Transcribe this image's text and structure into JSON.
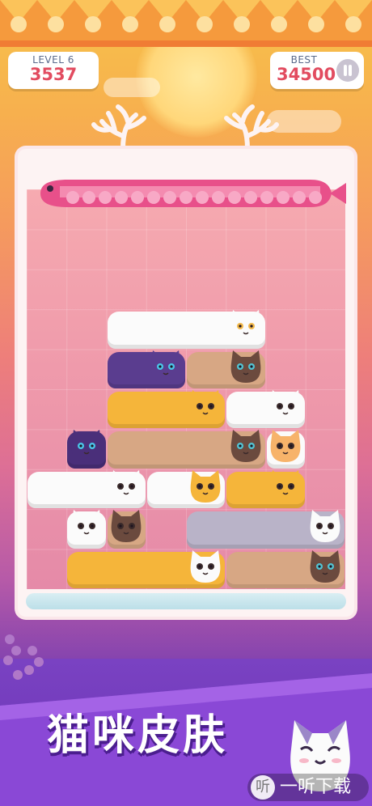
{
  "hud": {
    "level_label": "LEVEL 6",
    "score": "3537",
    "best_label": "BEST",
    "best_score": "34500"
  },
  "banner": {
    "title": "猫咪皮肤"
  },
  "watermark": {
    "icon": "听",
    "text": "一听下载"
  },
  "colors": {
    "score_red": "#e24c60",
    "frame": "#fdf3f3",
    "grid_pink": "#f2a0ac",
    "banner_purple": "#6a34b6"
  },
  "icons": [
    "pause-icon",
    "antler-icon",
    "fish-progress-icon",
    "lightning-icon"
  ],
  "board": {
    "rows": 10,
    "cols": 8,
    "cats": [
      {
        "row": 3,
        "col": 2,
        "len": 4,
        "color": "#fbfbfb",
        "face": "#fbfbfb",
        "eyes": "#f2b84a"
      },
      {
        "row": 4,
        "col": 2,
        "len": 2,
        "color": "#5a3d8f",
        "face": "#5a3d8f",
        "eyes": "#4ac5e8"
      },
      {
        "row": 4,
        "col": 4,
        "len": 2,
        "color": "#d7a784",
        "face": "#6b4a3e",
        "eyes": "#52c3d3"
      },
      {
        "row": 5,
        "col": 2,
        "len": 3,
        "color": "#f5b53a",
        "face": "#f5b53a",
        "eyes": "#3a2a2a"
      },
      {
        "row": 5,
        "col": 5,
        "len": 2,
        "color": "#fbfbfb",
        "face": "#fbfbfb",
        "eyes": "#3a2a2a"
      },
      {
        "row": 6,
        "col": 1,
        "len": 1,
        "color": "#4a2f7a",
        "face": "#4a2f7a",
        "eyes": "#4ac5e8"
      },
      {
        "row": 6,
        "col": 2,
        "len": 4,
        "color": "#d7a784",
        "face": "#6b4a3e",
        "eyes": "#52c3d3"
      },
      {
        "row": 6,
        "col": 6,
        "len": 1,
        "color": "#fbfbfb",
        "face": "#f7b36a",
        "eyes": "#3a2a2a"
      },
      {
        "row": 7,
        "col": 0,
        "len": 3,
        "color": "#fbfbfb",
        "face": "#fbfbfb",
        "eyes": "#3a2a2a"
      },
      {
        "row": 7,
        "col": 3,
        "len": 2,
        "color": "#fbfbfb",
        "face": "#f5b53a",
        "eyes": "#3a2a2a"
      },
      {
        "row": 7,
        "col": 5,
        "len": 2,
        "color": "#f5b53a",
        "face": "#f5b53a",
        "eyes": "#3a2a2a"
      },
      {
        "row": 8,
        "col": 1,
        "len": 1,
        "color": "#fbfbfb",
        "face": "#fbfbfb",
        "eyes": "#3a2a2a"
      },
      {
        "row": 8,
        "col": 2,
        "len": 1,
        "color": "#d7a784",
        "face": "#6b4a3e",
        "eyes": "#3a2a2a"
      },
      {
        "row": 8,
        "col": 4,
        "len": 4,
        "color": "#b9b3c8",
        "face": "#fbfbfb",
        "eyes": "#3a2a2a"
      },
      {
        "row": 9,
        "col": 1,
        "len": 4,
        "color": "#f5b53a",
        "face": "#fbfbfb",
        "eyes": "#3a2a2a"
      },
      {
        "row": 9,
        "col": 5,
        "len": 3,
        "color": "#d7a784",
        "face": "#6b4a3e",
        "eyes": "#52c3d3"
      }
    ]
  }
}
